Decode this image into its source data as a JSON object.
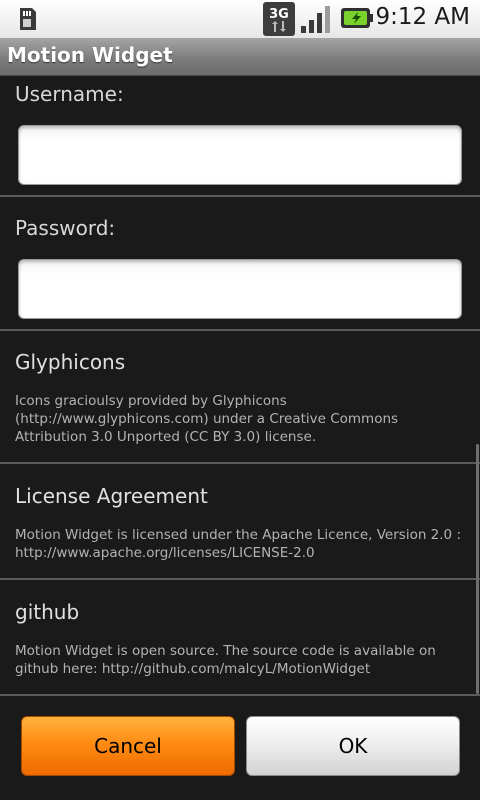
{
  "status_bar": {
    "time": "9:12 AM",
    "network_type": "3G",
    "icons": [
      "sd-card-icon",
      "3g-icon",
      "signal-icon",
      "battery-charging-icon"
    ]
  },
  "app": {
    "title": "Motion Widget"
  },
  "form": {
    "username_label": "Username:",
    "username_value": "",
    "password_label": "Password:",
    "password_value": ""
  },
  "preferences": [
    {
      "title": "Glyphicons",
      "summary": "Icons gracioulsy provided by Glyphicons (http://www.glyphicons.com) under a Creative Commons Attribution 3.0 Unported (CC BY 3.0) license."
    },
    {
      "title": "License Agreement",
      "summary": "Motion Widget is licensed under the Apache Licence, Version 2.0 : http://www.apache.org/licenses/LICENSE-2.0"
    },
    {
      "title": "github",
      "summary": "Motion Widget is open source. The source code is available on github here: http://github.com/malcyL/MotionWidget"
    }
  ],
  "buttons": {
    "cancel_label": "Cancel",
    "ok_label": "OK"
  },
  "colors": {
    "accent_orange": "#ff8c12",
    "background": "#1a1a1a"
  }
}
